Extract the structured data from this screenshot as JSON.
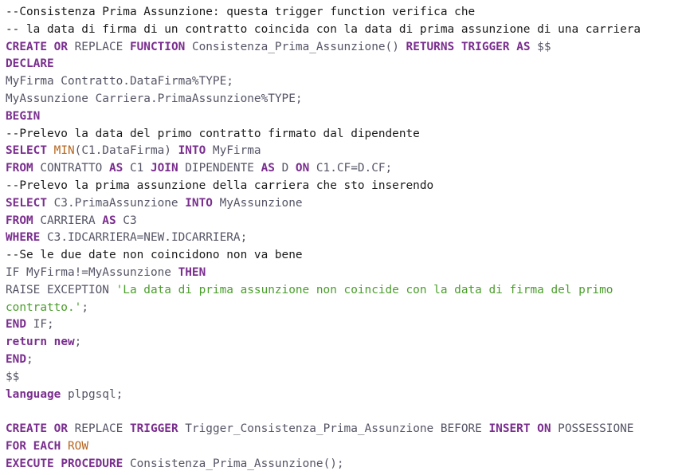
{
  "code": {
    "lines": [
      {
        "segments": [
          {
            "t": "cm",
            "v": "--Consistenza Prima Assunzione: questa trigger function verifica che"
          }
        ]
      },
      {
        "segments": [
          {
            "t": "cm",
            "v": "-- la data di firma di un contratto coincida con la data di prima assunzione di una carriera"
          }
        ]
      },
      {
        "segments": [
          {
            "t": "kw",
            "v": "CREATE"
          },
          {
            "t": "tx",
            "v": " "
          },
          {
            "t": "kw",
            "v": "OR"
          },
          {
            "t": "tx",
            "v": " REPLACE "
          },
          {
            "t": "kw",
            "v": "FUNCTION"
          },
          {
            "t": "tx",
            "v": " Consistenza_Prima_Assunzione() "
          },
          {
            "t": "kw",
            "v": "RETURNS"
          },
          {
            "t": "tx",
            "v": " "
          },
          {
            "t": "kw",
            "v": "TRIGGER"
          },
          {
            "t": "tx",
            "v": " "
          },
          {
            "t": "kw",
            "v": "AS"
          },
          {
            "t": "tx",
            "v": " $$"
          }
        ]
      },
      {
        "segments": [
          {
            "t": "kw",
            "v": "DECLARE"
          }
        ]
      },
      {
        "segments": [
          {
            "t": "tx",
            "v": "MyFirma Contratto.DataFirma%TYPE;"
          }
        ]
      },
      {
        "segments": [
          {
            "t": "tx",
            "v": "MyAssunzione Carriera.PrimaAssunzione%TYPE;"
          }
        ]
      },
      {
        "segments": [
          {
            "t": "kw",
            "v": "BEGIN"
          }
        ]
      },
      {
        "segments": [
          {
            "t": "cm",
            "v": "--Prelevo la data del primo contratto firmato dal dipendente"
          }
        ]
      },
      {
        "segments": [
          {
            "t": "kw",
            "v": "SELECT"
          },
          {
            "t": "tx",
            "v": " "
          },
          {
            "t": "fn",
            "v": "MIN"
          },
          {
            "t": "tx",
            "v": "(C1.DataFirma) "
          },
          {
            "t": "kw",
            "v": "INTO"
          },
          {
            "t": "tx",
            "v": " MyFirma"
          }
        ]
      },
      {
        "segments": [
          {
            "t": "kw",
            "v": "FROM"
          },
          {
            "t": "tx",
            "v": " CONTRATTO "
          },
          {
            "t": "kw",
            "v": "AS"
          },
          {
            "t": "tx",
            "v": " C1 "
          },
          {
            "t": "kw",
            "v": "JOIN"
          },
          {
            "t": "tx",
            "v": " DIPENDENTE "
          },
          {
            "t": "kw",
            "v": "AS"
          },
          {
            "t": "tx",
            "v": " D "
          },
          {
            "t": "kw",
            "v": "ON"
          },
          {
            "t": "tx",
            "v": " C1.CF=D.CF;"
          }
        ]
      },
      {
        "segments": [
          {
            "t": "cm",
            "v": "--Prelevo la prima assunzione della carriera che sto inserendo"
          }
        ]
      },
      {
        "segments": [
          {
            "t": "kw",
            "v": "SELECT"
          },
          {
            "t": "tx",
            "v": " C3.PrimaAssunzione "
          },
          {
            "t": "kw",
            "v": "INTO"
          },
          {
            "t": "tx",
            "v": " MyAssunzione"
          }
        ]
      },
      {
        "segments": [
          {
            "t": "kw",
            "v": "FROM"
          },
          {
            "t": "tx",
            "v": " CARRIERA "
          },
          {
            "t": "kw",
            "v": "AS"
          },
          {
            "t": "tx",
            "v": " C3"
          }
        ]
      },
      {
        "segments": [
          {
            "t": "kw",
            "v": "WHERE"
          },
          {
            "t": "tx",
            "v": " C3.IDCARRIERA=NEW.IDCARRIERA;"
          }
        ]
      },
      {
        "segments": [
          {
            "t": "cm",
            "v": "--Se le due date non coincidono non va bene"
          }
        ]
      },
      {
        "segments": [
          {
            "t": "tx",
            "v": "IF MyFirma!=MyAssunzione "
          },
          {
            "t": "kw",
            "v": "THEN"
          }
        ]
      },
      {
        "wrap": true,
        "segments": [
          {
            "t": "tx",
            "v": "RAISE EXCEPTION "
          },
          {
            "t": "st",
            "v": "'La data di prima assunzione non coincide con la data di firma del primo\ncontratto.'"
          },
          {
            "t": "tx",
            "v": ";"
          }
        ]
      },
      {
        "segments": [
          {
            "t": "kw",
            "v": "END"
          },
          {
            "t": "tx",
            "v": " IF;"
          }
        ]
      },
      {
        "segments": [
          {
            "t": "kw",
            "v": "return"
          },
          {
            "t": "tx",
            "v": " "
          },
          {
            "t": "kw",
            "v": "new"
          },
          {
            "t": "tx",
            "v": ";"
          }
        ]
      },
      {
        "segments": [
          {
            "t": "kw",
            "v": "END"
          },
          {
            "t": "tx",
            "v": ";"
          }
        ]
      },
      {
        "segments": [
          {
            "t": "tx",
            "v": "$$"
          }
        ]
      },
      {
        "segments": [
          {
            "t": "kw",
            "v": "language"
          },
          {
            "t": "tx",
            "v": " plpgsql;"
          }
        ]
      },
      {
        "segments": [
          {
            "t": "tx",
            "v": ""
          }
        ]
      },
      {
        "segments": [
          {
            "t": "kw",
            "v": "CREATE"
          },
          {
            "t": "tx",
            "v": " "
          },
          {
            "t": "kw",
            "v": "OR"
          },
          {
            "t": "tx",
            "v": " REPLACE "
          },
          {
            "t": "kw",
            "v": "TRIGGER"
          },
          {
            "t": "tx",
            "v": " Trigger_Consistenza_Prima_Assunzione BEFORE "
          },
          {
            "t": "kw",
            "v": "INSERT"
          },
          {
            "t": "tx",
            "v": " "
          },
          {
            "t": "kw",
            "v": "ON"
          },
          {
            "t": "tx",
            "v": " POSSESSIONE"
          }
        ]
      },
      {
        "segments": [
          {
            "t": "kw",
            "v": "FOR"
          },
          {
            "t": "tx",
            "v": " "
          },
          {
            "t": "kw",
            "v": "EACH"
          },
          {
            "t": "tx",
            "v": " "
          },
          {
            "t": "fn",
            "v": "ROW"
          }
        ]
      },
      {
        "segments": [
          {
            "t": "kw",
            "v": "EXECUTE"
          },
          {
            "t": "tx",
            "v": " "
          },
          {
            "t": "kw",
            "v": "PROCEDURE"
          },
          {
            "t": "tx",
            "v": " Consistenza_Prima_Assunzione();"
          }
        ]
      }
    ]
  }
}
